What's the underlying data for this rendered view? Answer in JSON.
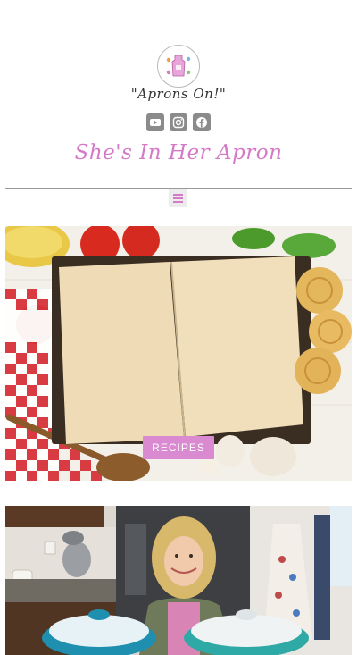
{
  "header": {
    "logo_icon": "apron-logo-icon",
    "tagline": "\"Aprons On!\"",
    "site_title": "She's In Her Apron"
  },
  "social": [
    {
      "icon": "youtube-icon"
    },
    {
      "icon": "instagram-icon"
    },
    {
      "icon": "facebook-icon"
    }
  ],
  "nav": {
    "menu_icon": "hamburger-menu-icon"
  },
  "hero": {
    "button_label": "RECIPES"
  },
  "colors": {
    "accent_pink": "#d57ac6",
    "button_pink": "#d98ad0",
    "social_gray": "#8b8b8b",
    "rule_gray": "#9a9a9a"
  }
}
